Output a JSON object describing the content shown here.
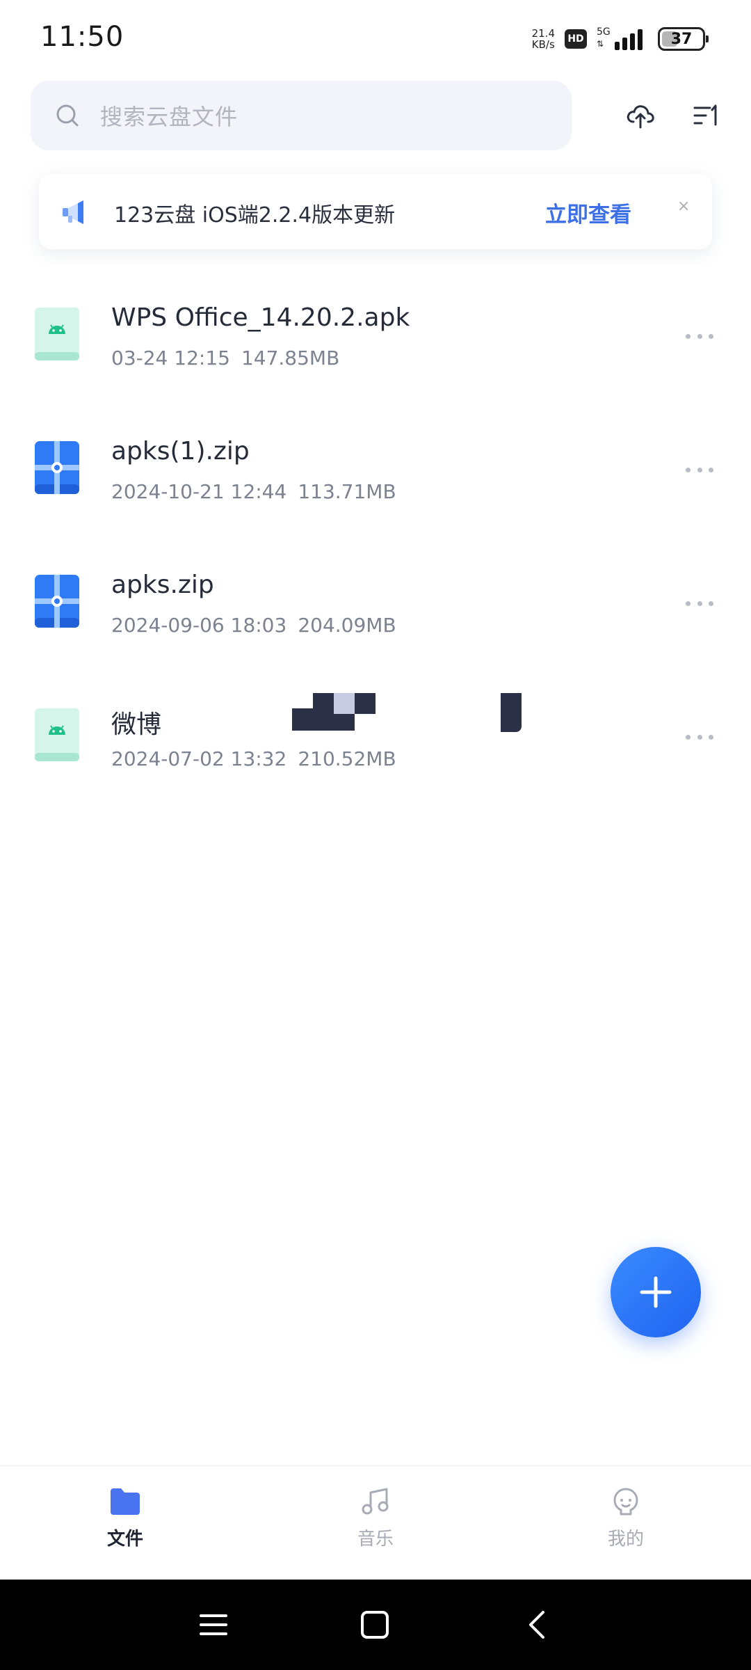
{
  "status_bar": {
    "time": "11:50",
    "net_speed_value": "21.4",
    "net_speed_unit": "KB/s",
    "hd": "HD",
    "network": "5G",
    "battery": "37"
  },
  "search": {
    "placeholder": "搜索云盘文件"
  },
  "header_icons": [
    "cloud-upload-icon",
    "sort-icon"
  ],
  "notice": {
    "text": "123云盘 iOS端2.2.4版本更新",
    "link": "立即查看",
    "close": "×"
  },
  "files": [
    {
      "name": "WPS Office_14.20.2.apk",
      "date": "03-24 12:15",
      "size": "147.85MB",
      "type": "android-apk-icon"
    },
    {
      "name": "apks(1).zip",
      "date": "2024-10-21 12:44",
      "size": "113.71MB",
      "type": "zip-archive-icon"
    },
    {
      "name": "apks.zip",
      "date": "2024-09-06 18:03",
      "size": "204.09MB",
      "type": "zip-archive-icon"
    },
    {
      "name": "微博",
      "date": "2024-07-02 13:32",
      "size": "210.52MB",
      "type": "android-apk-icon"
    }
  ],
  "bottom_nav": [
    {
      "label": "文件",
      "icon": "folder-icon",
      "active": true
    },
    {
      "label": "音乐",
      "icon": "music-icon",
      "active": false
    },
    {
      "label": "我的",
      "icon": "profile-icon",
      "active": false
    }
  ],
  "colors": {
    "accent": "#3d6fe6",
    "fab": "#2b7bff",
    "apk_icon": "#1ec08a",
    "zip_icon": "#2f7bf5"
  }
}
